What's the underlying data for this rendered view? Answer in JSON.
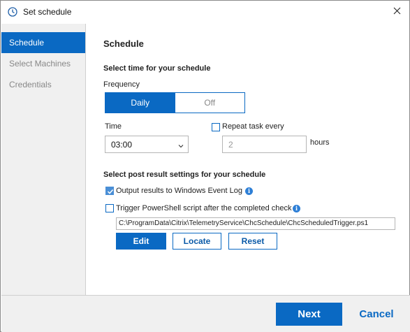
{
  "window": {
    "title": "Set schedule"
  },
  "sidebar": {
    "items": [
      {
        "label": "Schedule",
        "active": true
      },
      {
        "label": "Select Machines",
        "active": false
      },
      {
        "label": "Credentials",
        "active": false
      }
    ]
  },
  "main": {
    "heading": "Schedule",
    "time_section_title": "Select time for your schedule",
    "frequency_label": "Frequency",
    "frequency_options": [
      "Daily",
      "Off"
    ],
    "frequency_selected": "Daily",
    "time_label": "Time",
    "time_value": "03:00",
    "repeat_label": "Repeat task every",
    "repeat_checked": false,
    "repeat_value": "2",
    "repeat_unit": "hours",
    "post_section_title": "Select post result settings for your schedule",
    "output_event_log_label": "Output results to Windows Event Log",
    "output_event_log_checked": true,
    "trigger_script_label": "Trigger PowerShell script after the completed check",
    "trigger_script_checked": false,
    "script_path": "C:\\ProgramData\\Citrix\\TelemetryService\\ChcSchedule\\ChcScheduledTrigger.ps1",
    "buttons": {
      "edit": "Edit",
      "locate": "Locate",
      "reset": "Reset"
    }
  },
  "footer": {
    "next": "Next",
    "cancel": "Cancel"
  },
  "colors": {
    "accent": "#0a69c3",
    "sidebar_bg": "#f0f0f0",
    "muted_text": "#888888"
  },
  "icons": {
    "title": "clock-icon",
    "close": "close-icon",
    "dropdown": "chevron-down-icon",
    "info": "info-icon",
    "check": "checkmark-icon"
  }
}
